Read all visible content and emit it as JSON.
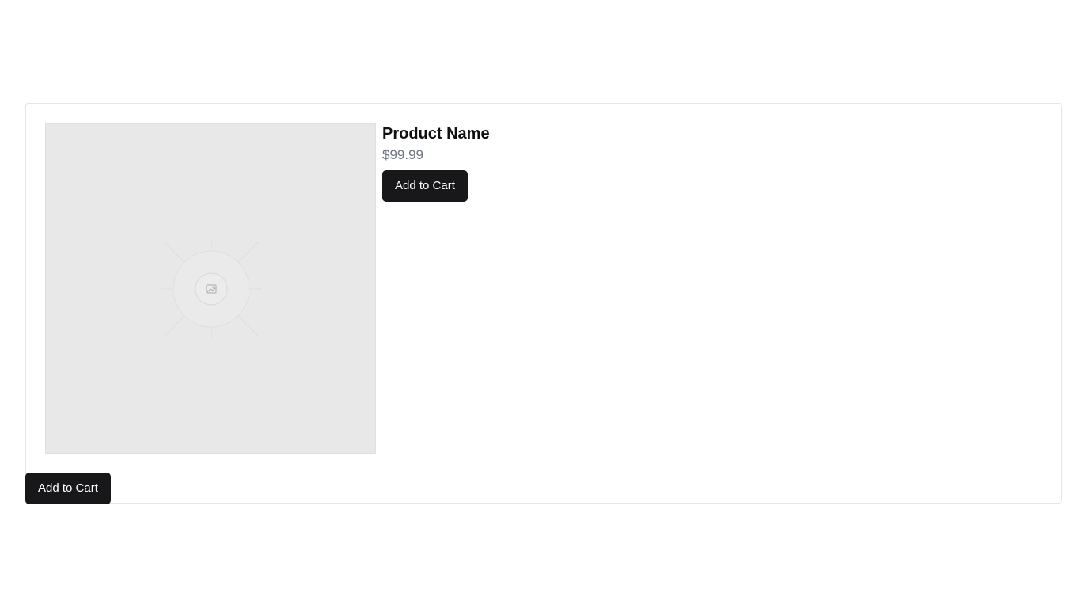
{
  "product": {
    "name": "Product Name",
    "price": "$99.99",
    "add_to_cart_label": "Add to Cart"
  },
  "footer": {
    "add_to_cart_label": "Add to Cart"
  },
  "image": {
    "icon": "image-placeholder-icon"
  },
  "colors": {
    "button_bg": "#18181b",
    "button_text": "#ffffff",
    "price_text": "#6b7280",
    "placeholder_bg": "#e8e8e8"
  }
}
